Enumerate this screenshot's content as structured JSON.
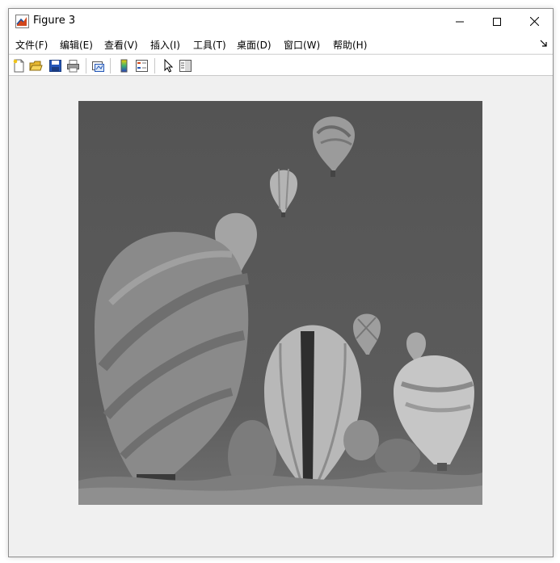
{
  "window": {
    "title": "Figure 3"
  },
  "window_controls": {
    "minimize": "minimize-icon",
    "maximize": "maximize-icon",
    "close": "close-icon"
  },
  "menu": {
    "items": [
      {
        "label": "文件(F)"
      },
      {
        "label": "编辑(E)"
      },
      {
        "label": "查看(V)"
      },
      {
        "label": "插入(I)"
      },
      {
        "label": "工具(T)"
      },
      {
        "label": "桌面(D)"
      },
      {
        "label": "窗口(W)"
      },
      {
        "label": "帮助(H)"
      }
    ]
  },
  "toolbar": {
    "icons": [
      "new-figure-icon",
      "open-file-icon",
      "save-icon",
      "print-icon",
      "link-plot-icon",
      "colorbar-icon",
      "legend-icon",
      "select-pointer-icon",
      "property-editor-icon"
    ]
  },
  "figure": {
    "content": "grayscale image of hot air balloons"
  },
  "colors": {
    "background": "#f0f0f0",
    "image_sky": "#555555"
  }
}
